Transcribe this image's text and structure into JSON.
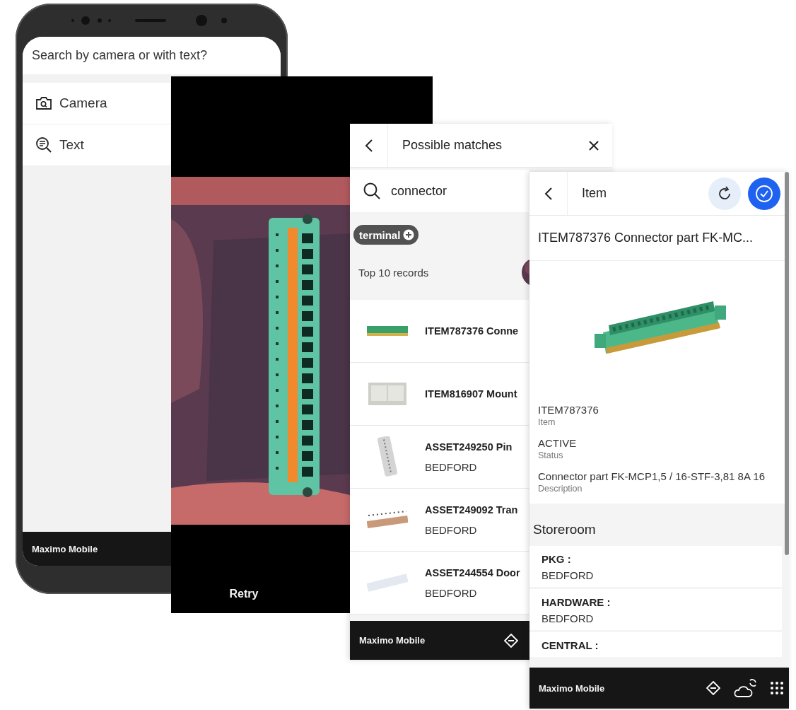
{
  "search_choice": {
    "title": "Search by camera or with text?",
    "options": [
      {
        "kind": "camera",
        "label": "Camera"
      },
      {
        "kind": "text",
        "label": "Text"
      }
    ],
    "footer": "Maximo Mobile"
  },
  "camera": {
    "action": "Retry"
  },
  "matches": {
    "title": "Possible matches",
    "query": "connector",
    "chips": [
      {
        "label": "terminal"
      }
    ],
    "summary": "Top 10 records",
    "results": [
      {
        "title": "ITEM787376 Conne"
      },
      {
        "title": "ITEM816907 Mount"
      },
      {
        "title": "ASSET249250 Pin",
        "subtitle": "BEDFORD"
      },
      {
        "title": "ASSET249092 Tran",
        "subtitle": "BEDFORD"
      },
      {
        "title": "ASSET244554 Door",
        "subtitle": "BEDFORD"
      }
    ],
    "footer": "Maximo Mobile"
  },
  "item": {
    "title": "Item",
    "heading": "ITEM787376 Connector part FK-MC...",
    "fields": [
      {
        "value": "ITEM787376",
        "label": "Item"
      },
      {
        "value": "ACTIVE",
        "label": "Status"
      },
      {
        "value": "Connector part FK-MCP1,5 / 16-STF-3,81 8A 16",
        "label": "Description"
      }
    ],
    "section": "Storeroom",
    "storerooms": [
      {
        "name": "PKG :",
        "site": "BEDFORD"
      },
      {
        "name": "HARDWARE :",
        "site": "BEDFORD"
      },
      {
        "name": "CENTRAL :"
      }
    ],
    "footer": "Maximo Mobile"
  }
}
